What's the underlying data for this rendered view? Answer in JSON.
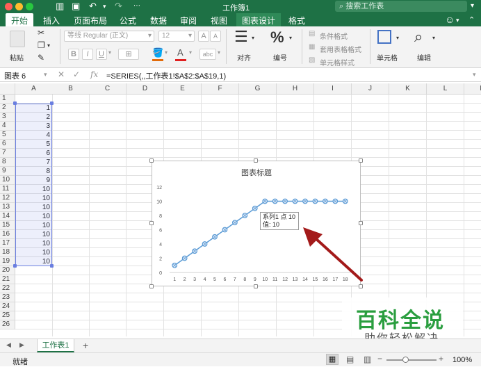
{
  "app": {
    "title": "工作簿1",
    "search_placeholder": "搜索工作表"
  },
  "tabs": [
    "开始",
    "插入",
    "页面布局",
    "公式",
    "数据",
    "审阅",
    "视图",
    "图表设计",
    "格式"
  ],
  "ribbon": {
    "paste_label": "粘贴",
    "font_name": "等线 Regular (正文)",
    "font_size": "12",
    "align_label": "对齐",
    "number_label": "编号",
    "conditional_format": "条件格式",
    "table_format": "套用表格格式",
    "cell_style": "单元格样式",
    "cells_label": "单元格",
    "edit_label": "编辑",
    "percent_icon": "%"
  },
  "formula_bar": {
    "name_box": "图表 6",
    "fx": "fx",
    "formula": "=SERIES(,,工作表1!$A$2:$A$19,1)"
  },
  "grid": {
    "columns": [
      "A",
      "B",
      "C",
      "D",
      "E",
      "F",
      "G",
      "H",
      "I",
      "J",
      "K",
      "L",
      "M"
    ],
    "rows": [
      "1",
      "2",
      "3",
      "4",
      "5",
      "6",
      "7",
      "8",
      "9",
      "10",
      "11",
      "12",
      "13",
      "14",
      "15",
      "16",
      "17",
      "18",
      "19",
      "20",
      "21",
      "22",
      "23",
      "24",
      "25",
      "26"
    ],
    "col_a_values": [
      "",
      "1",
      "2",
      "3",
      "4",
      "5",
      "6",
      "7",
      "8",
      "9",
      "10",
      "10",
      "10",
      "10",
      "10",
      "10",
      "10",
      "10",
      "10"
    ]
  },
  "chart_data": {
    "type": "line",
    "title": "图表标题",
    "categories": [
      "1",
      "2",
      "3",
      "4",
      "5",
      "6",
      "7",
      "8",
      "9",
      "10",
      "11",
      "12",
      "13",
      "14",
      "15",
      "16",
      "17",
      "18"
    ],
    "series": [
      {
        "values": [
          1,
          2,
          3,
          4,
          5,
          6,
          7,
          8,
          9,
          10,
          10,
          10,
          10,
          10,
          10,
          10,
          10,
          10
        ],
        "color": "#5b9bd5"
      }
    ],
    "ylim": [
      0,
      12
    ],
    "yticks": [
      "0",
      "2",
      "4",
      "6",
      "8",
      "10",
      "12"
    ],
    "grid": false,
    "tooltip": {
      "line1": "系列1 点 10",
      "line2": "值: 10"
    }
  },
  "sheets": {
    "active": "工作表1",
    "add_label": "+"
  },
  "status": {
    "text": "就绪",
    "zoom": "100%"
  },
  "watermark": {
    "main": "百科全说",
    "sub": "助你轻松解决"
  }
}
